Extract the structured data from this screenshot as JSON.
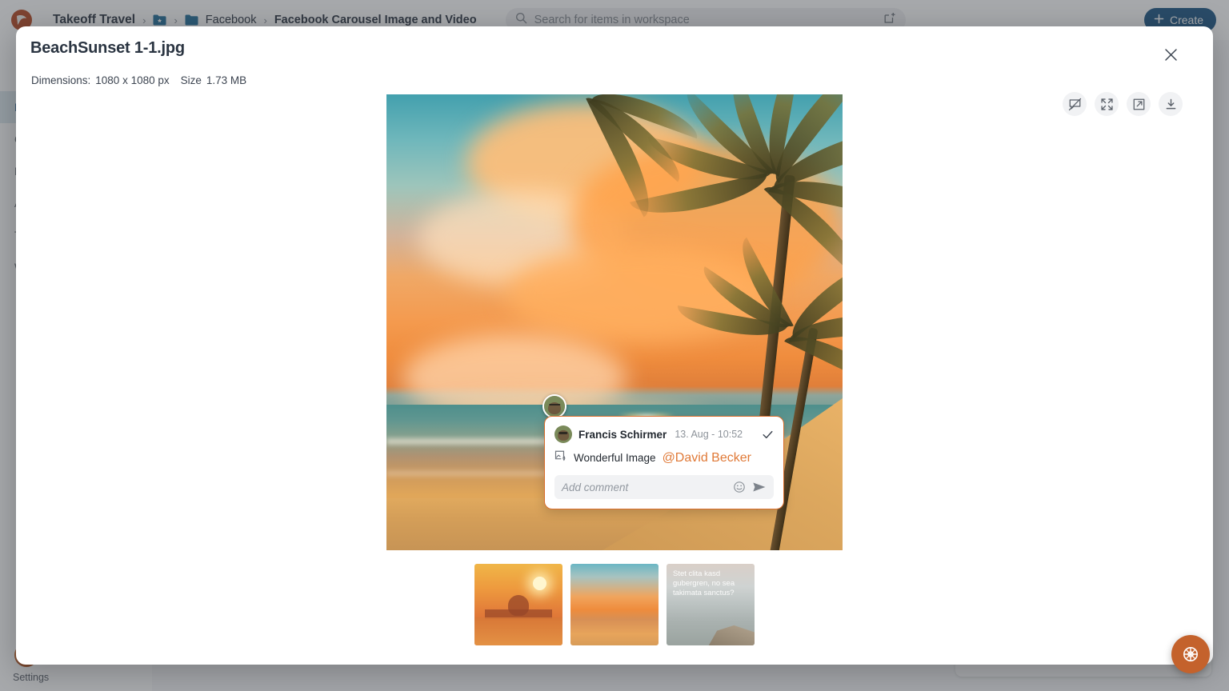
{
  "app": {
    "brand_name": "Takeoff Travel",
    "logo_icon": "bird-logo-icon",
    "breadcrumb": [
      {
        "label": "Takeoff Travel",
        "icon": "",
        "current": false
      },
      {
        "label": "",
        "icon": "starred-folder-icon",
        "current": false
      },
      {
        "label": "Facebook",
        "icon": "folder-icon",
        "current": false
      },
      {
        "label": "Facebook Carousel Image and Video",
        "icon": "",
        "current": true
      }
    ],
    "search": {
      "placeholder": "Search for items in workspace",
      "value": "",
      "icon": "search-icon",
      "trailing_icon": "new-item-icon"
    },
    "create_button": {
      "label": "Create",
      "icon": "plus-icon"
    },
    "fab": {
      "icon": "globe-icon"
    },
    "sidebar": {
      "items": [
        {
          "label": "Br",
          "active": true
        },
        {
          "label": "Ca",
          "active": false
        },
        {
          "label": "Ka",
          "active": false
        },
        {
          "label": "A",
          "active": false
        },
        {
          "label": "Te",
          "active": false
        },
        {
          "label": "Wo",
          "active": false
        }
      ],
      "settings_label": "Settings",
      "avatar": "user-avatar"
    }
  },
  "modal": {
    "title": "BeachSunset 1-1.jpg",
    "meta": {
      "dimensions_label": "Dimensions:",
      "dimensions_value": "1080 x 1080 px",
      "size_label": "Size",
      "size_value": "1.73 MB"
    },
    "close_icon": "close-icon",
    "tools": [
      {
        "name": "comment-off-icon",
        "label": "Hide comments"
      },
      {
        "name": "fullscreen-icon",
        "label": "Fullscreen"
      },
      {
        "name": "open-external-icon",
        "label": "Open in new tab"
      },
      {
        "name": "download-icon",
        "label": "Download"
      }
    ],
    "comment": {
      "author": "Francis Schirmer",
      "timestamp": "13. Aug - 10:52",
      "text": "Wonderful Image",
      "mention": "@David Becker",
      "resolve_icon": "check-icon",
      "annotation_icon": "image-pin-icon",
      "input_placeholder": "Add comment",
      "input_value": "",
      "emoji_icon": "emoji-icon",
      "send_icon": "send-icon",
      "accent_color": "#d96f2e"
    },
    "thumbnails": [
      {
        "name": "taj-mahal-sunset",
        "caption": "",
        "selected": false
      },
      {
        "name": "beach-sunset-palm",
        "caption": "",
        "selected": true
      },
      {
        "name": "coastal-overlook",
        "caption": "Stet clita kasd gubergren, no sea takimata sanctus?",
        "selected": false
      }
    ]
  }
}
